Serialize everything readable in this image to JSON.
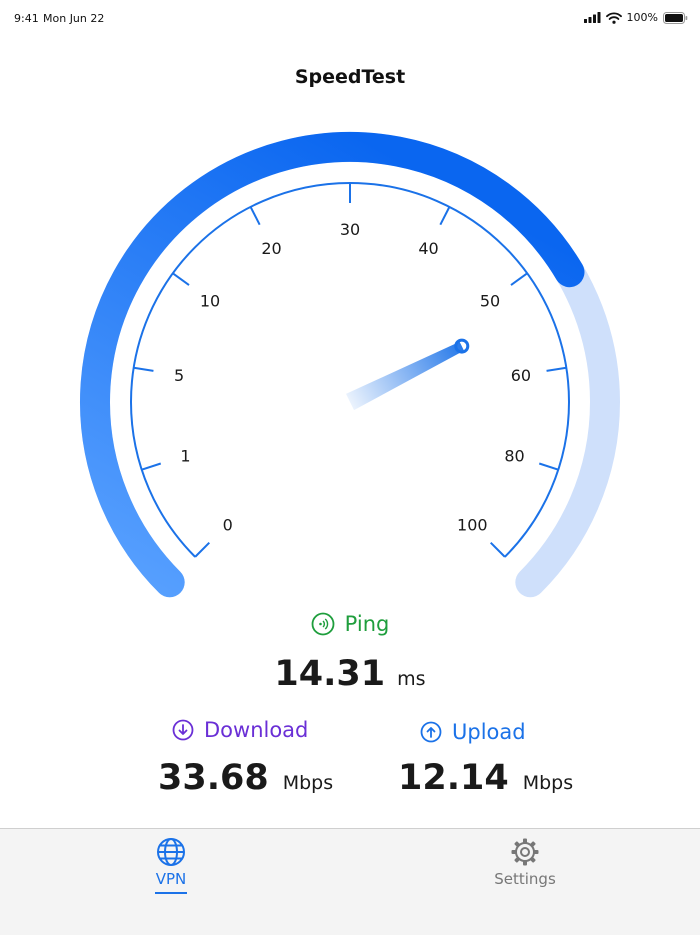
{
  "status_bar": {
    "time": "9:41",
    "date": "Mon Jun 22",
    "battery": "100%"
  },
  "title": "SpeedTest",
  "gauge": {
    "labels": [
      "0",
      "1",
      "5",
      "10",
      "20",
      "30",
      "40",
      "50",
      "60",
      "80",
      "100"
    ],
    "needle_value": 53.5,
    "progress_value": 52
  },
  "ping": {
    "label": "Ping",
    "value": "14.31",
    "unit": "ms"
  },
  "download": {
    "label": "Download",
    "value": "33.68",
    "unit": "Mbps"
  },
  "upload": {
    "label": "Upload",
    "value": "12.14",
    "unit": "Mbps"
  },
  "tabs": [
    {
      "label": "VPN",
      "icon": "globe-icon",
      "active": true
    },
    {
      "label": "Settings",
      "icon": "gear-icon",
      "active": false
    }
  ],
  "colors": {
    "accent": "#1b72e8",
    "ping": "#1f9e3d",
    "download": "#6a2fd6",
    "gauge_track": "#cfe0fb"
  }
}
